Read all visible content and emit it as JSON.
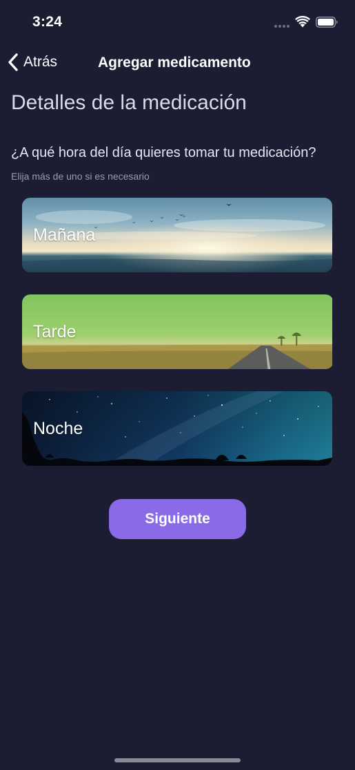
{
  "status_bar": {
    "time": "3:24",
    "icons": [
      "signal-dots-icon",
      "wifi-icon",
      "battery-icon"
    ]
  },
  "nav": {
    "back_label": "Atrás",
    "title": "Agregar medicamento"
  },
  "content": {
    "page_title": "Detalles de la medicación",
    "question": "¿A qué hora del día quieres tomar tu medicación?",
    "hint": "Elija más de uno si es necesario",
    "options": [
      {
        "label": "Mañana",
        "image": "sunrise-sea-image"
      },
      {
        "label": "Tarde",
        "image": "green-field-road-image"
      },
      {
        "label": "Noche",
        "image": "starry-night-sky-image"
      }
    ],
    "next_label": "Siguiente"
  },
  "colors": {
    "background": "#1c1d33",
    "accent": "#8a6ae6",
    "text": "#ffffff"
  }
}
